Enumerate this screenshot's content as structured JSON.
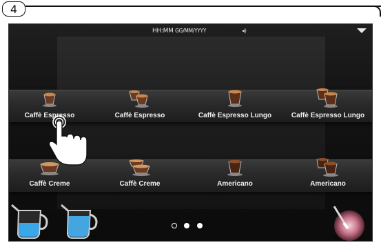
{
  "step_number": "4",
  "status": {
    "time": "HH:MM",
    "date": "GG/MM/YYYY"
  },
  "row1": [
    {
      "label": "Caffè Espresso",
      "cup": "small-cup"
    },
    {
      "label": "Caffè Espresso",
      "cup": "double-small-cup"
    },
    {
      "label": "Caffè Espresso Lungo",
      "cup": "medium-cup"
    },
    {
      "label": "Caffè Espresso Lungo",
      "cup": "double-medium-cup"
    }
  ],
  "row2": [
    {
      "label": "Caffè Creme",
      "cup": "wide-cup"
    },
    {
      "label": "Caffè Creme",
      "cup": "double-wide-cup"
    },
    {
      "label": "Americano",
      "cup": "tall-cup"
    },
    {
      "label": "Americano",
      "cup": "double-tall-cup"
    }
  ],
  "pager": {
    "pages": 3,
    "current": 1
  },
  "icons": [
    "volume-icon",
    "menu-arrow-icon",
    "hot-water-jug-icon",
    "milk-jug-icon",
    "steam-wand-icon",
    "hand-tap-icon"
  ],
  "colors": {
    "screen_bg": "#101010",
    "shelf": "#2b2b2b",
    "text": "#f2f2f2",
    "water_blue": "#3aa7e8",
    "steam_glow": "#c8738a"
  }
}
